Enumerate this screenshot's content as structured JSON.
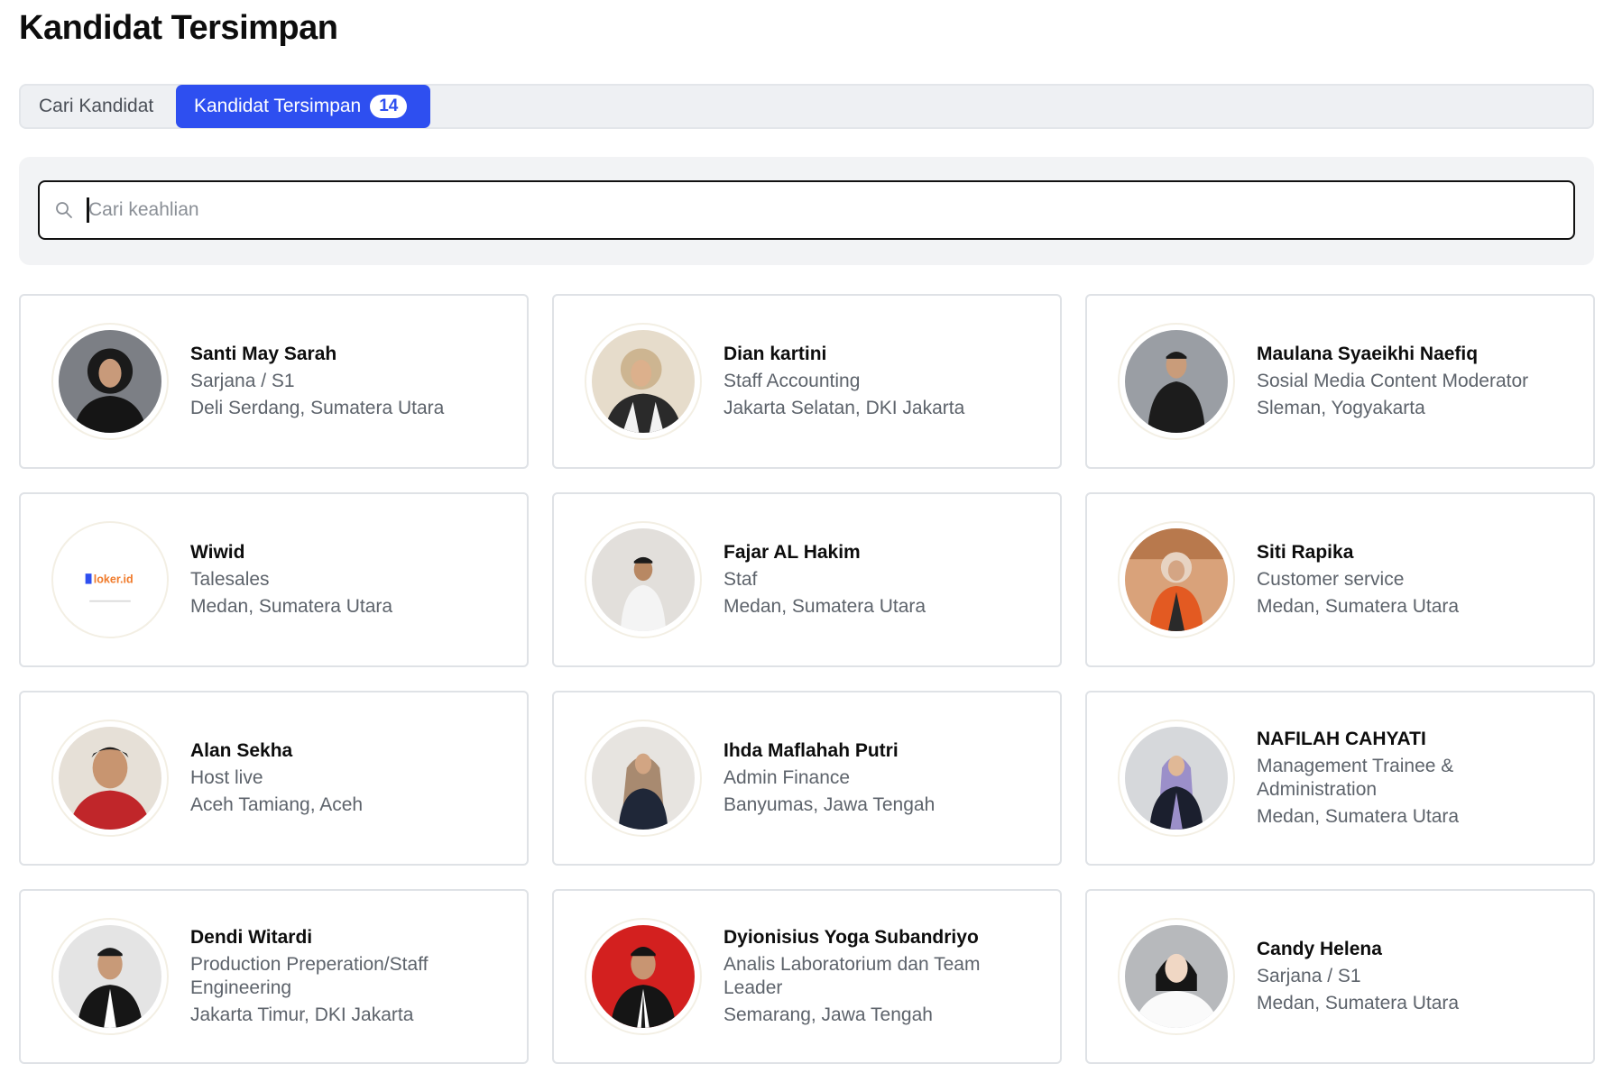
{
  "page": {
    "title": "Kandidat Tersimpan"
  },
  "tabs": {
    "search_label": "Cari Kandidat",
    "saved_label": "Kandidat Tersimpan",
    "saved_count": "14"
  },
  "search": {
    "placeholder": "Cari keahlian",
    "value": ""
  },
  "colors": {
    "accent": "#2e4ff0"
  },
  "candidates": [
    {
      "name": "Santi May Sarah",
      "role": "Sarjana / S1",
      "location": "Deli Serdang, Sumatera Utara",
      "avatar": "photo-woman-hijab-black"
    },
    {
      "name": "Dian kartini",
      "role": "Staff Accounting",
      "location": "Jakarta Selatan, DKI Jakarta",
      "avatar": "photo-woman-hijab-beige"
    },
    {
      "name": "Maulana Syaeikhi Naefiq",
      "role": "Sosial Media Content Moderator",
      "location": "Sleman, Yogyakarta",
      "avatar": "photo-man-black-shirt"
    },
    {
      "name": "Wiwid",
      "role": "Talesales",
      "location": "Medan, Sumatera Utara",
      "avatar": "loker-logo",
      "avatar_text": "loker.id"
    },
    {
      "name": "Fajar AL Hakim",
      "role": "Staf",
      "location": "Medan, Sumatera Utara",
      "avatar": "photo-man-white-shirt"
    },
    {
      "name": "Siti Rapika",
      "role": "Customer service",
      "location": "Medan, Sumatera Utara",
      "avatar": "photo-woman-orange-blazer"
    },
    {
      "name": "Alan Sekha",
      "role": "Host live",
      "location": "Aceh Tamiang, Aceh",
      "avatar": "photo-man-red-jacket"
    },
    {
      "name": "Ihda Maflahah Putri",
      "role": "Admin Finance",
      "location": "Banyumas, Jawa Tengah",
      "avatar": "photo-woman-hijab-navy"
    },
    {
      "name": "NAFILAH CAHYATI",
      "role": "Management Trainee & Administration",
      "location": "Medan, Sumatera Utara",
      "avatar": "photo-woman-hijab-lilac"
    },
    {
      "name": "Dendi Witardi",
      "role": "Production Preperation/Staff Engineering",
      "location": "Jakarta Timur, DKI Jakarta",
      "avatar": "photo-man-black-suit"
    },
    {
      "name": "Dyionisius Yoga Subandriyo",
      "role": "Analis Laboratorium dan Team Leader",
      "location": "Semarang, Jawa Tengah",
      "avatar": "photo-man-red-background"
    },
    {
      "name": "Candy Helena",
      "role": "Sarjana / S1",
      "location": "Medan, Sumatera Utara",
      "avatar": "photo-woman-hijab-white"
    }
  ]
}
